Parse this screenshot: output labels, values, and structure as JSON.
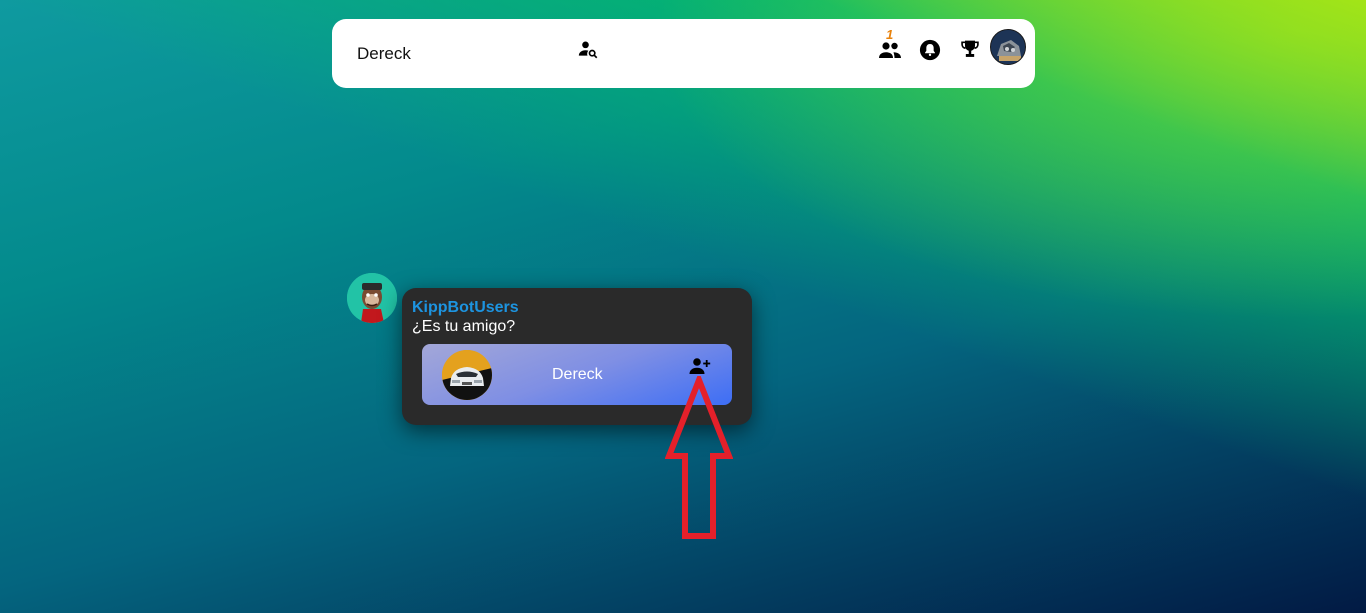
{
  "header": {
    "user_name": "Dereck",
    "icons": {
      "search": "user-search-icon",
      "friends": "friends-icon",
      "notifications": "bell-icon",
      "ranking": "trophy-icon",
      "profile": "profile-avatar"
    },
    "friend_requests_badge": "1"
  },
  "chat": {
    "sender_name": "KippBotUsers",
    "message": "¿Es tu amigo?",
    "friend_card": {
      "name": "Dereck",
      "action_icon": "add-friend-icon"
    }
  },
  "colors": {
    "sender_name": "#1d94e0",
    "badge": "#e8820c",
    "annotation_arrow": "#e4202a",
    "bubble_bg": "#2a2a2a"
  }
}
